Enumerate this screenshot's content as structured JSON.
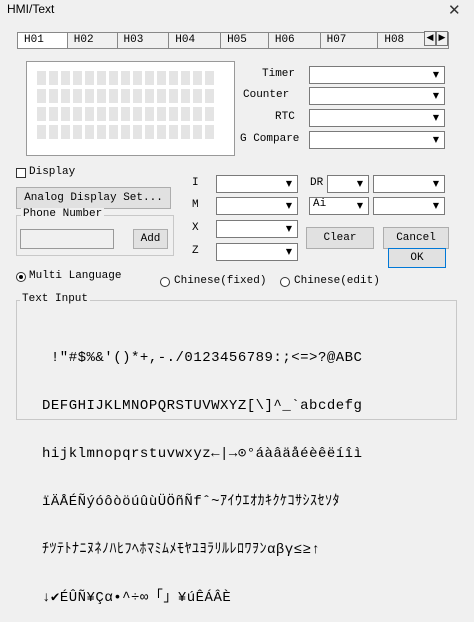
{
  "window": {
    "title": "HMI/Text",
    "close_glyph": "✕"
  },
  "tabs": [
    {
      "label": "H01",
      "active": true
    },
    {
      "label": "H02"
    },
    {
      "label": "H03"
    },
    {
      "label": "H04"
    },
    {
      "label": "H05"
    },
    {
      "label": "H06"
    },
    {
      "label": "H07"
    },
    {
      "label": "H08"
    }
  ],
  "tab_scroll": {
    "left": "◀",
    "right": "▶"
  },
  "right_fields": {
    "timer": "Timer",
    "counter": "Counter",
    "rtc": "RTC",
    "g_compare": "G Compare"
  },
  "display_checkbox": {
    "label": "Display",
    "checked": false
  },
  "analog_button": "Analog Display Set...",
  "phone": {
    "group_label": "Phone Number",
    "value": "",
    "add": "Add"
  },
  "middle_labels": {
    "i": "I",
    "m": "M",
    "x": "X",
    "z": "Z"
  },
  "dr": {
    "label": "DR",
    "ai_value": "Ai"
  },
  "buttons": {
    "clear": "Clear",
    "cancel": "Cancel",
    "ok": "OK"
  },
  "language": {
    "multi": "Multi Language",
    "chinese_fixed": "Chinese(fixed)",
    "chinese_edit": "Chinese(edit)",
    "selected": "multi"
  },
  "text_input": {
    "label": "Text Input",
    "lines": [
      " !\"#$%&'()*+,-./0123456789:;<=>?@ABC",
      "DEFGHIJKLMNOPQRSTUVWXYZ[\\]^_`abcdefg",
      "hijklmnopqrstuvwxyz←|→⊙°áàâäåéèêëíîì",
      "ïÄÅÉÑýóôòöúûùÜÖñÑfˆ~ｱｲｳｴｵｶｷｸｹｺｻｼｽｾｿﾀ",
      "ﾁﾂﾃﾄﾅﾆﾇﾈﾉﾊﾋﾌﾍﾎﾏﾐﾑﾒﾓﾔﾕﾖﾗﾘﾙﾚﾛﾜｦﾝαβγ≤≥↑",
      "↓✔ÉÛÑ¥Çα•^÷∞「」¥úÊÁÂÈ"
    ]
  }
}
